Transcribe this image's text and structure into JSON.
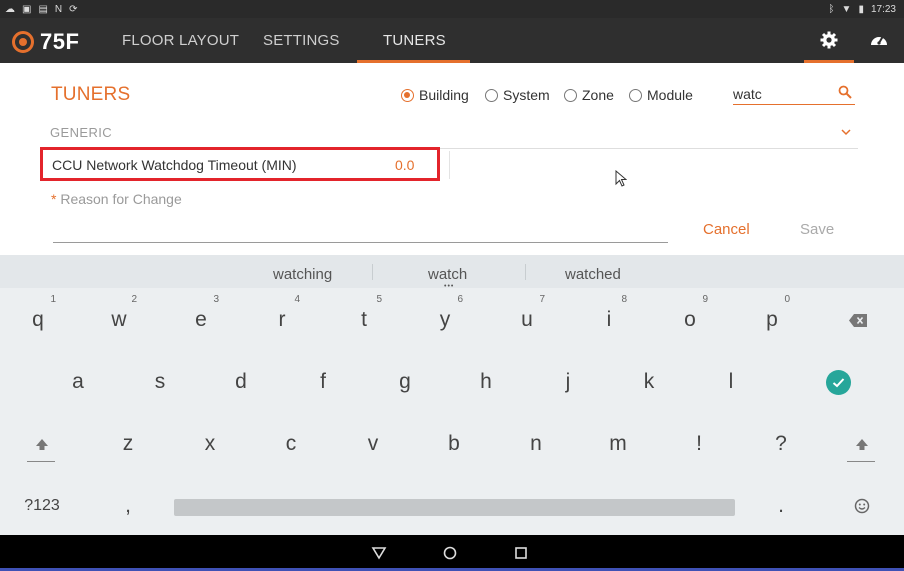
{
  "status_bar": {
    "time": "17:23",
    "left_icons": [
      "cloud-icon",
      "image-icon",
      "doc-icon",
      "n-icon",
      "sync-icon"
    ],
    "right_icons": [
      "bluetooth-icon",
      "wifi-icon",
      "battery-icon"
    ]
  },
  "app": {
    "logo_text": "75F",
    "tabs": [
      {
        "label": "FLOOR LAYOUT"
      },
      {
        "label": "SETTINGS"
      },
      {
        "label": "TUNERS",
        "active": true
      }
    ],
    "action_icons": [
      "gear-icon",
      "dashboard-gauge-icon"
    ],
    "accent_color": "#e5702d"
  },
  "tuners": {
    "title": "TUNERS",
    "scope_options": [
      {
        "label": "Building",
        "selected": true
      },
      {
        "label": "System",
        "selected": false
      },
      {
        "label": "Zone",
        "selected": false
      },
      {
        "label": "Module",
        "selected": false
      }
    ],
    "search": {
      "value": "watc"
    },
    "group": {
      "label": "GENERIC"
    },
    "tuner": {
      "name": "CCU Network Watchdog Timeout (MIN)",
      "value": "0.0"
    },
    "reason": {
      "required_mark": "*",
      "label": " Reason for Change"
    },
    "cancel_label": "Cancel",
    "save_label": "Save"
  },
  "keyboard": {
    "suggestions": [
      "watching",
      "watch",
      "watched"
    ],
    "row1": [
      {
        "key": "q",
        "hint": "1"
      },
      {
        "key": "w",
        "hint": "2"
      },
      {
        "key": "e",
        "hint": "3"
      },
      {
        "key": "r",
        "hint": "4"
      },
      {
        "key": "t",
        "hint": "5"
      },
      {
        "key": "y",
        "hint": "6"
      },
      {
        "key": "u",
        "hint": "7"
      },
      {
        "key": "i",
        "hint": "8"
      },
      {
        "key": "o",
        "hint": "9"
      },
      {
        "key": "p",
        "hint": "0"
      }
    ],
    "row2": [
      "a",
      "s",
      "d",
      "f",
      "g",
      "h",
      "j",
      "k",
      "l"
    ],
    "row3": [
      "z",
      "x",
      "c",
      "v",
      "b",
      "n",
      "m",
      "!",
      "?"
    ],
    "symbols_label": "?123",
    "comma_label": ",",
    "period_label": ".",
    "enter_color": "#26a69a"
  },
  "navbar": {
    "icons": [
      "back-icon",
      "home-icon",
      "recents-icon"
    ]
  }
}
